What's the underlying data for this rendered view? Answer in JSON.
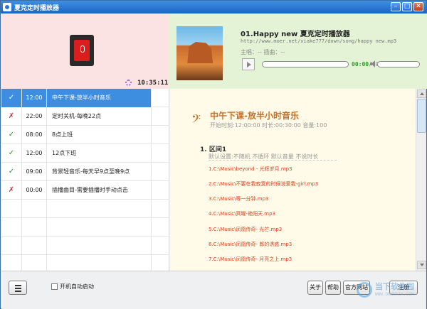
{
  "window": {
    "title": "夏克定时播放器",
    "minimize": "–",
    "maximize": "□",
    "close": "✕"
  },
  "clock": {
    "time": "10:35:11"
  },
  "player": {
    "song_title": "01.Happy new 夏克定时播放器",
    "url": "http://www.moer.net/xiake777/down/song/happy new.mp3",
    "singer": "主唱：--     插曲：--",
    "time_current": "00:00",
    "time_sep": "/",
    "time_total": "00:00"
  },
  "schedule": {
    "rows": [
      {
        "status": "✓",
        "status_type": "ok",
        "time": "12:00",
        "name": "中午下课-放半小时音乐",
        "selected": true
      },
      {
        "status": "✗",
        "status_type": "no",
        "time": "22:00",
        "name": "定时关机-每晚22点",
        "selected": false
      },
      {
        "status": "✓",
        "status_type": "ok",
        "time": "08:00",
        "name": "8点上班",
        "selected": false
      },
      {
        "status": "✓",
        "status_type": "ok",
        "time": "12:00",
        "name": "12点下班",
        "selected": false
      },
      {
        "status": "✓",
        "status_type": "ok",
        "time": "09:00",
        "name": "背景轻音乐-每天早9点至晚9点",
        "selected": false
      },
      {
        "status": "✗",
        "status_type": "no",
        "time": "00:00",
        "name": "插播曲目-需要插播时手动点击",
        "selected": false
      }
    ]
  },
  "detail": {
    "note_icon": "𝄢",
    "title": "中午下课-放半小时音乐",
    "subtitle": "开始时刻:12:00:00   时长:00:30:00   音量:100",
    "section_title": "1. 区间1",
    "section_sub": "默认设置:不随机  不循环  默认音量  不说时长",
    "files": [
      "1.C:\\Music\\beyond - 光辉岁月.mp3",
      "2.C:\\Music\\不要在我寂寞的时候说爱我-girl.mp3",
      "3.C:\\Music\\等一分钟.mp3",
      "4.C:\\Music\\冥曜-艳阳天.mp3",
      "5.C:\\Music\\凤凰传奇- 光芒.mp3",
      "6.C:\\Music\\凤凰传奇- 郎的诱惑.mp3",
      "7.C:\\Music\\凤凰传奇- 月亮之上.mp3"
    ]
  },
  "bottom": {
    "menu_icon": "menu-icon",
    "autostart_label": "开机自动启动",
    "about_label": "关于",
    "help_label": "帮助",
    "website_label": "官方网站",
    "register_label": "注册"
  },
  "watermark": {
    "title": "当下软件园",
    "url": "WWW.DOWNXIA.COM"
  },
  "colors": {
    "accent": "#3d8ee0",
    "title_orange": "#c87028",
    "file_red": "#d84020",
    "ok_green": "#2a9a2a",
    "no_red": "#d03030"
  }
}
